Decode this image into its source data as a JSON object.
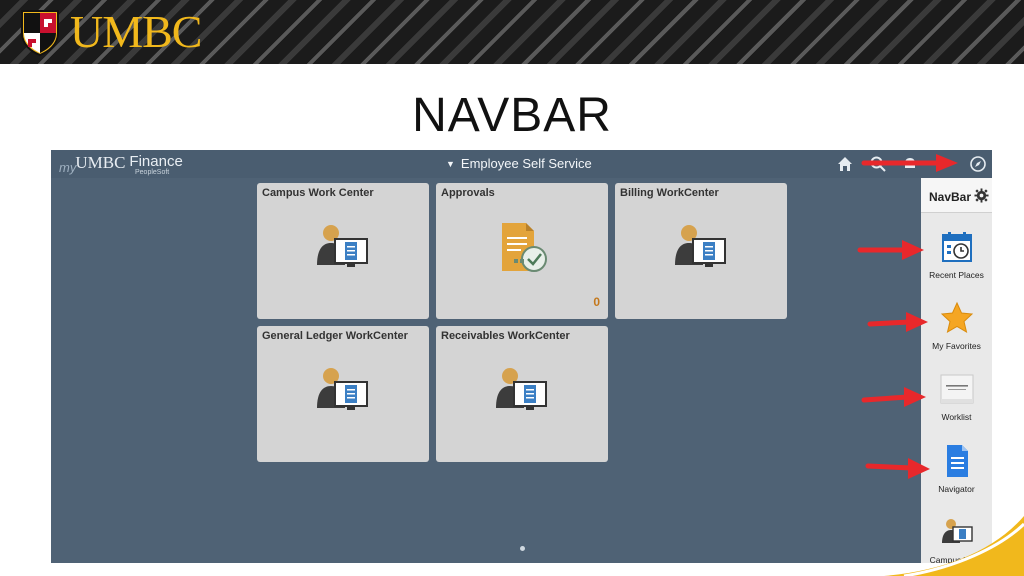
{
  "header": {
    "logo_text": "UMBC"
  },
  "slide": {
    "title": "NAVBAR"
  },
  "app": {
    "brand_prefix": "my",
    "brand_name": "UMBC",
    "brand_suffix": "Finance",
    "brand_sub": "PeopleSoft",
    "homepage_selector": "Employee Self Service",
    "icons": [
      "home-icon",
      "search-icon",
      "notification-icon",
      "navbar-compass-icon"
    ],
    "tiles": [
      {
        "label": "Campus Work Center",
        "icon": "workcenter-person-icon"
      },
      {
        "label": "Approvals",
        "icon": "approvals-document-icon",
        "count": "0"
      },
      {
        "label": "Billing WorkCenter",
        "icon": "workcenter-person-icon"
      },
      {
        "label": "General Ledger WorkCenter",
        "icon": "workcenter-person-icon"
      },
      {
        "label": "Receivables WorkCenter",
        "icon": "workcenter-person-icon"
      }
    ]
  },
  "navbar": {
    "title": "NavBar",
    "items": [
      {
        "label": "Recent Places",
        "icon": "recent-places-icon"
      },
      {
        "label": "My Favorites",
        "icon": "star-icon"
      },
      {
        "label": "Worklist",
        "icon": "oracle-worklist-icon"
      },
      {
        "label": "Navigator",
        "icon": "navigator-document-icon"
      },
      {
        "label": "Campus Work Center",
        "icon": "workcenter-person-icon"
      }
    ]
  },
  "colors": {
    "banner_gold": "#f1b81c",
    "app_background": "#4f6275",
    "tile_background": "#d4d4d4",
    "arrow_red": "#e8282b",
    "count_orange": "#c4781c"
  }
}
